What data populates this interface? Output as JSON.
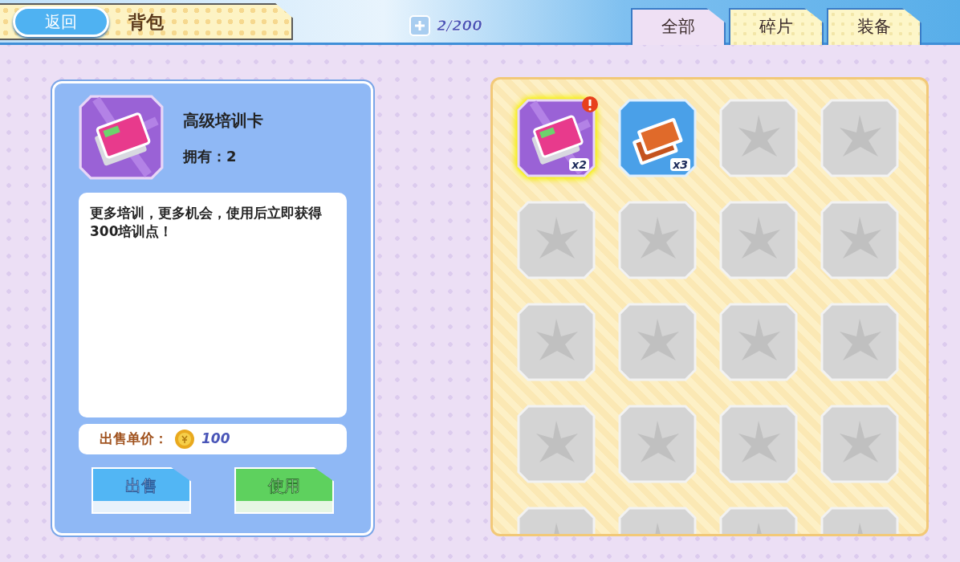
{
  "header": {
    "back_label": "返回",
    "title": "背包",
    "capacity": "2/200"
  },
  "tabs": [
    {
      "label": "全部",
      "selected": true
    },
    {
      "label": "碎片",
      "selected": false
    },
    {
      "label": "装备",
      "selected": false
    }
  ],
  "detail": {
    "kind": "card_purple",
    "name": "高级培训卡",
    "owned": "拥有：2",
    "description": "更多培训，更多机会，使用后立即获得300培训点！",
    "price_label": "出售单价：",
    "price": "100",
    "buttons": [
      {
        "label": "出售",
        "kind": "sell"
      },
      {
        "label": "使用",
        "kind": "use"
      }
    ]
  },
  "slots": [
    {
      "kind": "card_purple",
      "selected": true,
      "alert": true,
      "count": "x2"
    },
    {
      "kind": "card_orange",
      "selected": false,
      "alert": false,
      "count": "x3"
    },
    {
      "kind": "empty"
    },
    {
      "kind": "empty"
    },
    {
      "kind": "empty"
    },
    {
      "kind": "empty"
    },
    {
      "kind": "empty"
    },
    {
      "kind": "empty"
    },
    {
      "kind": "empty"
    },
    {
      "kind": "empty"
    },
    {
      "kind": "empty"
    },
    {
      "kind": "empty"
    },
    {
      "kind": "empty"
    },
    {
      "kind": "empty"
    },
    {
      "kind": "empty"
    },
    {
      "kind": "empty"
    },
    {
      "kind": "empty"
    },
    {
      "kind": "empty"
    },
    {
      "kind": "empty"
    },
    {
      "kind": "empty"
    }
  ]
}
